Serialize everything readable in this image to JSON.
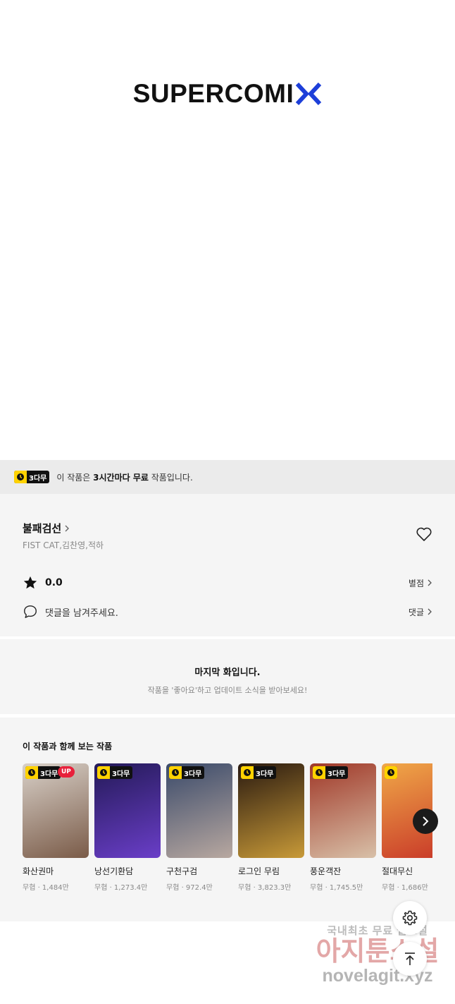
{
  "brand": {
    "logo_text": "SUPERCOMI",
    "accent": "#1d3fd9"
  },
  "free_notice": {
    "badge": "3다무",
    "prefix": "이 작품은 ",
    "bold": "3시간마다 무료",
    "suffix": " 작품입니다."
  },
  "work": {
    "title": "불패검선",
    "authors": "FIST CAT,김찬영,적하",
    "rating": "0.0",
    "rating_link": "별점",
    "comment_placeholder": "댓글을 남겨주세요.",
    "comment_link": "댓글"
  },
  "last_episode": {
    "title": "마지막 화입니다.",
    "subtitle": "작품을 '좋아요'하고 업데이트 소식을 받아보세요!"
  },
  "recommendations": {
    "heading": "이 작품과 함께 보는 작품",
    "items": [
      {
        "name": "화산권마",
        "meta": "무협 · 1,484만",
        "badge": "3다무",
        "up": "UP",
        "colors": [
          "#d8d0c8",
          "#7a5b48"
        ]
      },
      {
        "name": "낭선기환담",
        "meta": "무협 · 1,273.4만",
        "badge": "3다무",
        "colors": [
          "#241a58",
          "#6a3ec8"
        ]
      },
      {
        "name": "구천구검",
        "meta": "무협 · 972.4만",
        "badge": "3다무",
        "colors": [
          "#3a4a6a",
          "#b8a8a0"
        ]
      },
      {
        "name": "로그인 무림",
        "meta": "무협 · 3,823.3만",
        "badge": "3다무",
        "colors": [
          "#2a1a10",
          "#c89a38"
        ]
      },
      {
        "name": "풍운객잔",
        "meta": "무협 · 1,745.5만",
        "badge": "3다무",
        "colors": [
          "#a03828",
          "#d8c0a8"
        ]
      },
      {
        "name": "절대무신",
        "meta": "무협 · 1,686만",
        "badge": "",
        "colors": [
          "#f0a848",
          "#c83828"
        ]
      }
    ]
  },
  "watermark": {
    "line1": "국내최초 무료 웹소설",
    "line2": "아지툰소설",
    "line3": "novelagit.xyz"
  }
}
